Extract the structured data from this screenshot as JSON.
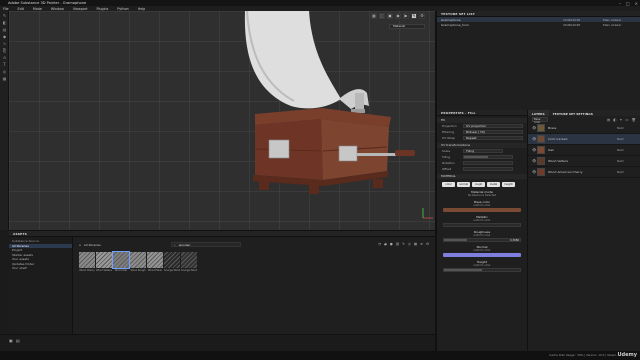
{
  "window": {
    "title": "Adobe Substance 3D Painter - Gramophone"
  },
  "menu": [
    "File",
    "Edit",
    "Mode",
    "Window",
    "Viewport",
    "Plugins",
    "Python",
    "Help"
  ],
  "viewport": {
    "display_mode": "Material"
  },
  "texture_set_list": {
    "title": "TEXTURE SET LIST",
    "rows": [
      {
        "name": "Gramophone",
        "resolution": "2048x2048",
        "shader": "Main shader"
      },
      {
        "name": "Gramophone_horn",
        "resolution": "2048x2048",
        "shader": "Main shader"
      }
    ]
  },
  "properties": {
    "title": "PROPERTIES - FILL",
    "fill_section": "Fill",
    "fields": [
      {
        "label": "Projection",
        "value": "UV projection"
      },
      {
        "label": "Filtering",
        "value": "Bilinear | HQ"
      },
      {
        "label": "UV Wrap",
        "value": "Repeat"
      }
    ],
    "uv_section": "UV transformations",
    "scale": {
      "label": "Scale",
      "value": "Tiling"
    },
    "tiling_label": "Tiling",
    "rotation_label": "Rotation",
    "offset_label": "Offset",
    "material_section": "MATERIAL",
    "channels": [
      "color",
      "normal",
      "rough",
      "metal",
      "height"
    ],
    "material_mode": {
      "title": "Material mode",
      "value": "No Resource Selected"
    },
    "params": [
      {
        "name": "Base color",
        "sub": "uniform color",
        "kind": "swatch",
        "color": "#7a4a35"
      },
      {
        "name": "Metallic",
        "sub": "uniform color",
        "kind": "slider",
        "level": 0.0
      },
      {
        "name": "Roughness",
        "sub": "uniform color",
        "kind": "slider",
        "level": 0.3,
        "readout": "0.3086"
      },
      {
        "name": "Normal",
        "sub": "uniform color",
        "kind": "swatch",
        "color": "#7f7fdf"
      },
      {
        "name": "Height",
        "sub": "uniform color",
        "kind": "slider",
        "level": 0.5
      }
    ]
  },
  "layers": {
    "tabs": [
      "LAYERS",
      "TEXTURE SET SETTINGS"
    ],
    "blend_mode": "Base color",
    "items": [
      {
        "name": "Brass",
        "blend": "Norm",
        "thumb": "#6a5a3a"
      },
      {
        "name": "Cold cracked",
        "blend": "Norm",
        "thumb": "#6b4a36"
      },
      {
        "name": "Oak",
        "blend": "Norm",
        "thumb": "#7a4a35"
      },
      {
        "name": "Wood Veltera",
        "blend": "Norm",
        "thumb": "#5a3a2a"
      },
      {
        "name": "Wood American Cherry",
        "blend": "Norm",
        "thumb": "#6e3c2c"
      }
    ]
  },
  "assets": {
    "title": "ASSETS",
    "side_header": "Substance Source",
    "side_items": [
      "All libraries",
      "Project",
      "Starter assets",
      "Your assets",
      "Updates folder",
      "Your shelf"
    ],
    "breadcrumb": "All libraries",
    "search": "wooden",
    "thumbs": [
      {
        "name": "Wood Cherry",
        "color": "#8a8a8a"
      },
      {
        "name": "Wood Veltera",
        "color": "#9a9a9a"
      },
      {
        "name": "Wood Oak",
        "color": "#7e7e7e"
      },
      {
        "name": "Wood Rough",
        "color": "#8c8c8c"
      },
      {
        "name": "Wood Plank",
        "color": "#949494"
      },
      {
        "name": "Grunge Wood",
        "color": "#2a2a2a"
      },
      {
        "name": "Grunge Wood 2",
        "color": "#333333"
      }
    ]
  },
  "status": {
    "version": "Cache Disk Usage : 39% | Version: 10.0 | Steam..",
    "brand": "Udemy"
  }
}
